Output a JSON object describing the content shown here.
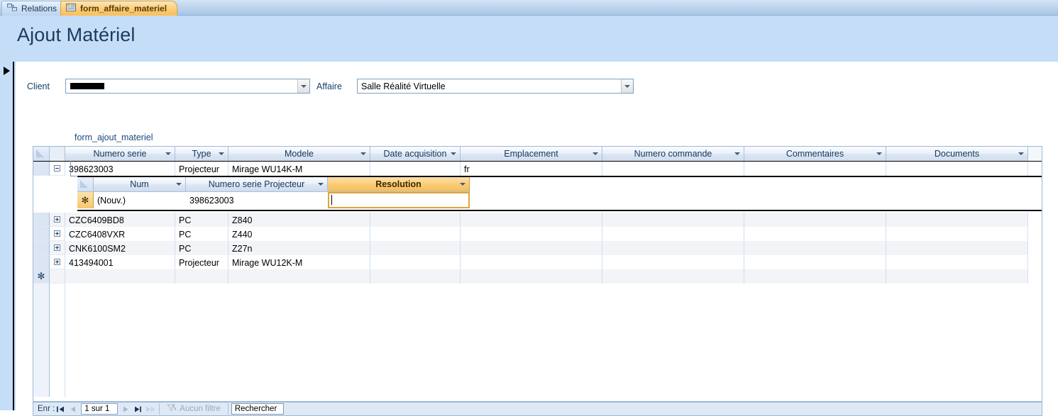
{
  "tabs": [
    {
      "label": "Relations",
      "icon": "relations-icon",
      "active": false
    },
    {
      "label": "form_affaire_materiel",
      "icon": "form-icon",
      "active": true
    }
  ],
  "header": {
    "title": "Ajout Matériel"
  },
  "fields": {
    "client_label": "Client",
    "client_value": "",
    "client_redacted": true,
    "affaire_label": "Affaire",
    "affaire_value": "Salle Réalité Virtuelle"
  },
  "subform_caption": "form_ajout_materiel",
  "datasheet": {
    "columns": [
      "Numero serie",
      "Type",
      "Modele",
      "Date acquisition",
      "Emplacement",
      "Numero commande",
      "Commentaires",
      "Documents"
    ],
    "rows": [
      {
        "expanded": true,
        "cells": [
          "398623003",
          "Projecteur",
          "Mirage WU14K-M",
          "",
          "fr",
          "",
          "",
          ""
        ]
      },
      {
        "expanded": false,
        "cells": [
          "CZC6409BD8",
          "PC",
          "Z840",
          "",
          "",
          "",
          "",
          ""
        ]
      },
      {
        "expanded": false,
        "cells": [
          "CZC6408VXR",
          "PC",
          "Z440",
          "",
          "",
          "",
          "",
          ""
        ]
      },
      {
        "expanded": false,
        "cells": [
          "CNK6100SM2",
          "PC",
          "Z27n",
          "",
          "",
          "",
          "",
          ""
        ]
      },
      {
        "expanded": false,
        "cells": [
          "413494001",
          "Projecteur",
          "Mirage WU12K-M",
          "",
          "",
          "",
          "",
          ""
        ]
      }
    ],
    "new_row_marker": "✻"
  },
  "subdatasheet": {
    "columns": [
      "Num",
      "Numero serie Projecteur",
      "Resolution"
    ],
    "selected_column": "Resolution",
    "new_row_marker": "✻",
    "rows": [
      {
        "cells": [
          "(Nouv.)",
          "398623003",
          ""
        ]
      }
    ]
  },
  "navbar": {
    "record_label": "Enr :",
    "record_position": "1 sur 1",
    "first_icon": "first-record-icon",
    "prev_icon": "previous-record-icon",
    "next_icon": "next-record-icon",
    "last_icon": "last-record-icon",
    "new_icon": "new-record-icon",
    "filter_label": "Aucun filtre",
    "filter_icon": "filter-icon",
    "search_placeholder": "Rechercher",
    "search_value": "Rechercher"
  },
  "colors": {
    "form_background": "#c5ddf7",
    "accent_orange": "#f6bc56",
    "title_text": "#1b3a5e",
    "tab_active": "#fbcd78"
  }
}
